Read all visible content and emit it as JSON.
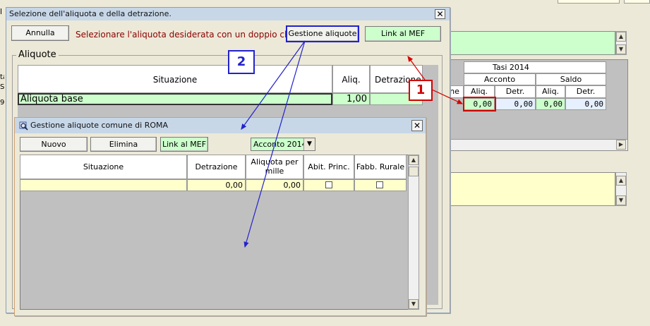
{
  "background": {
    "tasi_header": "Tasi 2014",
    "acconto": "Acconto",
    "saldo": "Saldo",
    "partial_col": "ne",
    "cols": [
      "Aliq.",
      "Detr.",
      "Aliq.",
      "Detr."
    ],
    "values": [
      "0,00",
      "0,00",
      "0,00",
      "0,00"
    ],
    "left_edge_chars": [
      "l",
      "ta",
      "S",
      "9"
    ]
  },
  "dialog_aliquota": {
    "title": "Selezione dell'aliquota e della detrazione.",
    "close_glyph": "✕",
    "annulla_label": "Annulla",
    "instruction": "Selezionare l'aliquota desiderata con un doppio click",
    "gestione_label": "Gestione aliquote",
    "link_mef_label": "Link al MEF",
    "group_label": "Aliquote",
    "columns": [
      "Situazione",
      "Aliq.",
      "Detrazione"
    ],
    "rows": [
      {
        "situazione": "Aliquota base",
        "aliq": "1,00",
        "detrazione": ""
      }
    ]
  },
  "dialog_gestione": {
    "title": "Gestione aliquote comune di ROMA",
    "close_glyph": "✕",
    "nuovo_label": "Nuovo",
    "elimina_label": "Elimina",
    "link_mef_label": "Link al MEF",
    "select_value": "Acconto 2014",
    "columns": [
      "Situazione",
      "Detrazione",
      "Aliquota per mille",
      "Abit. Princ.",
      "Fabb. Rurale"
    ],
    "rows": [
      {
        "situazione": "",
        "detrazione": "0,00",
        "aliquota": "0,00",
        "abit": false,
        "fabb": false
      }
    ]
  },
  "callouts": {
    "one": "1",
    "two": "2"
  },
  "colors": {
    "callout_red": "#d40000",
    "callout_blue": "#2222cc",
    "green_fill": "#ccffcc",
    "yellow_fill": "#ffffcc"
  }
}
